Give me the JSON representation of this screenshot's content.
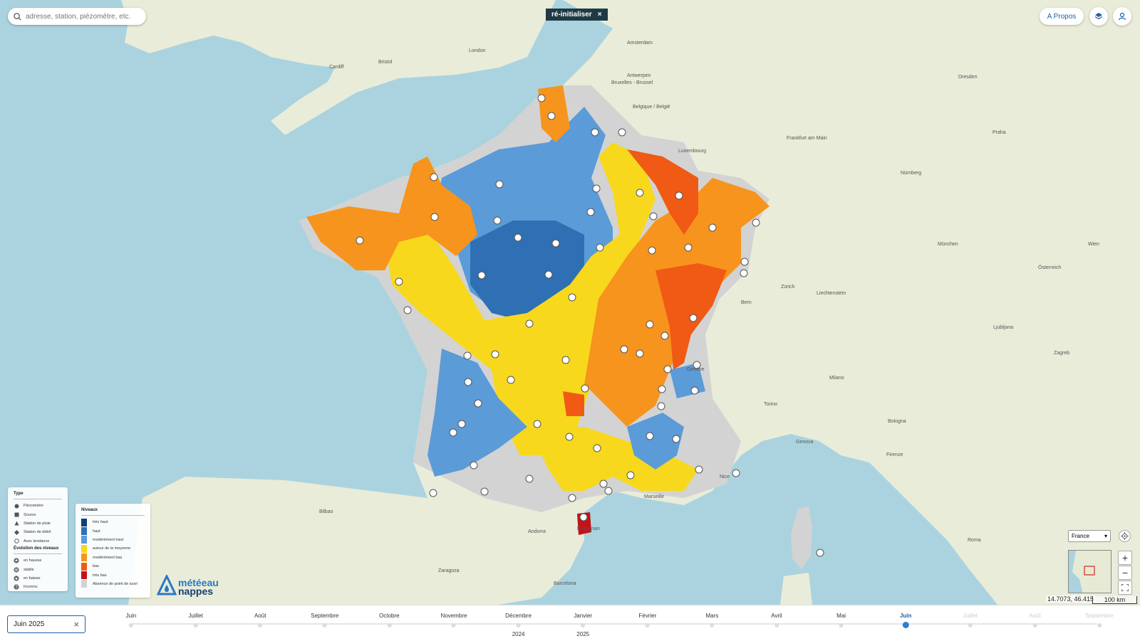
{
  "search": {
    "placeholder": "adresse, station, piézomètre, etc."
  },
  "reset_chip": {
    "label": "ré-initialiser",
    "close": "×"
  },
  "header": {
    "about_label": "A Propos"
  },
  "legend_type": {
    "title": "Type",
    "items": [
      {
        "label": "Piézomètre",
        "shape": "circle"
      },
      {
        "label": "Source",
        "shape": "square"
      },
      {
        "label": "Station de pluie",
        "shape": "triangle"
      },
      {
        "label": "Station de débit",
        "shape": "diamond"
      },
      {
        "label": "Avec tendance",
        "shape": "ring"
      }
    ],
    "evolution_title": "Évolution des niveaux",
    "evolution_items": [
      {
        "label": "en hausse",
        "icon": "arrow-up-icon"
      },
      {
        "label": "stable",
        "icon": "equal-icon"
      },
      {
        "label": "en baisse",
        "icon": "arrow-down-icon"
      },
      {
        "label": "Inconnu",
        "icon": "question-icon"
      }
    ]
  },
  "legend_levels": {
    "title": "Niveaux",
    "items": [
      {
        "label": "très haut",
        "color": "#0d3f7a"
      },
      {
        "label": "haut",
        "color": "#2f6fb3"
      },
      {
        "label": "modérément haut",
        "color": "#5b9bd8"
      },
      {
        "label": "autour de la moyenne",
        "color": "#f8d81c"
      },
      {
        "label": "modérément bas",
        "color": "#f7941d"
      },
      {
        "label": "bas",
        "color": "#f05a14"
      },
      {
        "label": "très bas",
        "color": "#c0141a"
      },
      {
        "label": "Absence de point de suivi",
        "color": "#d3d3d3"
      }
    ]
  },
  "logo": {
    "line1": "météeau",
    "line2": "nappes"
  },
  "map": {
    "labels": [
      "London",
      "Bristol",
      "Cardiff",
      "Amsterdam",
      "Antwerpen",
      "Bruxelles - Brussel",
      "Belgique / België",
      "Luxembourg",
      "Frankfurt am Main",
      "Nürnberg",
      "München",
      "Zürich",
      "Bern",
      "Genève",
      "Milano",
      "Torino",
      "Genova",
      "Bologna",
      "Firenze",
      "Roma",
      "Barcelona",
      "Andorra",
      "Zaragoza",
      "Bilbao",
      "Praha",
      "Wien",
      "Ljubljana",
      "Zagreb",
      "Dresden",
      "Marseille",
      "Nice",
      "Perpignan",
      "Österreich",
      "Liechtenstein"
    ],
    "country_select": "France",
    "coordinates": "14.7073, 46.415",
    "scale": "100 km",
    "zoom_in": "+",
    "zoom_out": "−"
  },
  "timeline": {
    "current_value": "Juin 2025",
    "clear": "×",
    "months": [
      {
        "label": "Juin",
        "state": "past"
      },
      {
        "label": "Juillet",
        "state": "past"
      },
      {
        "label": "Août",
        "state": "past"
      },
      {
        "label": "Septembre",
        "state": "past"
      },
      {
        "label": "Octobre",
        "state": "past"
      },
      {
        "label": "Novembre",
        "state": "past"
      },
      {
        "label": "Décembre",
        "state": "past"
      },
      {
        "label": "Janvier",
        "state": "past"
      },
      {
        "label": "Février",
        "state": "past"
      },
      {
        "label": "Mars",
        "state": "past"
      },
      {
        "label": "Avril",
        "state": "past"
      },
      {
        "label": "Mai",
        "state": "past"
      },
      {
        "label": "Juin",
        "state": "active"
      },
      {
        "label": "Juillet",
        "state": "future"
      },
      {
        "label": "Août",
        "state": "future"
      },
      {
        "label": "Septembre",
        "state": "future"
      }
    ],
    "years": [
      {
        "label": "2024",
        "month_index": 6
      },
      {
        "label": "2025",
        "month_index": 7
      }
    ]
  }
}
